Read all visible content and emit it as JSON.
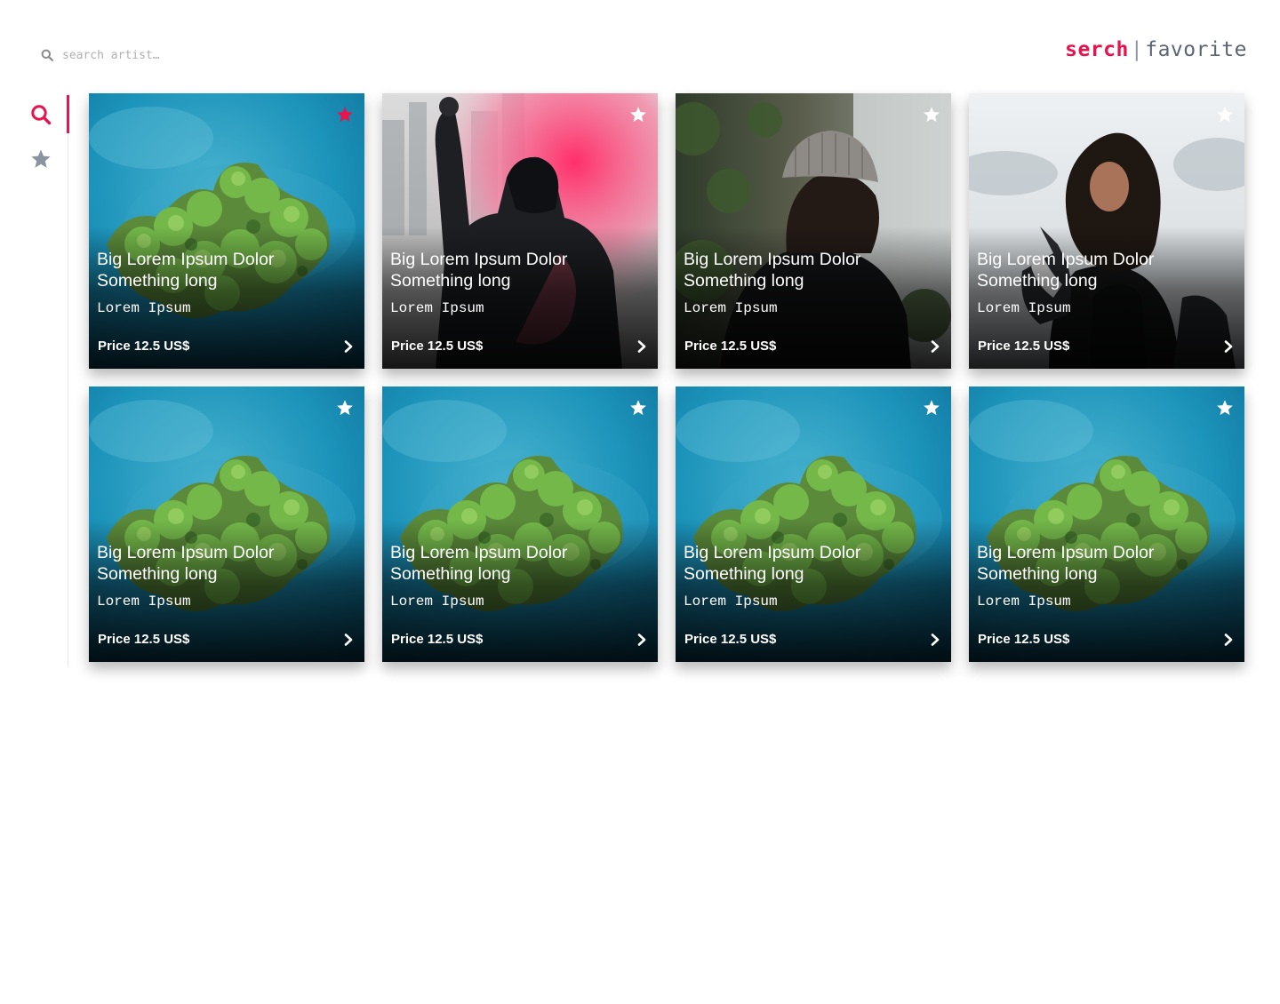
{
  "header": {
    "search_placeholder": "search artist…",
    "logo_brand": "serch",
    "logo_separator": "|",
    "logo_section": "favorite"
  },
  "sidebar": {
    "items": [
      {
        "icon": "search-icon",
        "active": true
      },
      {
        "icon": "star-icon",
        "active": false
      }
    ]
  },
  "colors": {
    "accent": "#e8124d",
    "inactive_icon": "#8a93a0"
  },
  "cards": [
    {
      "title": "Big Lorem Ipsum Dolor Something long",
      "artist": "Lorem Ipsum",
      "price": "Price 12.5 US$",
      "image": "aerial-island",
      "favorited": true
    },
    {
      "title": "Big Lorem Ipsum Dolor Something long",
      "artist": "Lorem Ipsum",
      "price": "Price 12.5 US$",
      "image": "hooded-person-pink-smoke",
      "favorited": false
    },
    {
      "title": "Big Lorem Ipsum Dolor Something long",
      "artist": "Lorem Ipsum",
      "price": "Price 12.5 US$",
      "image": "person-beanie-waterfall",
      "favorited": false
    },
    {
      "title": "Big Lorem Ipsum Dolor Something long",
      "artist": "Lorem Ipsum",
      "price": "Price 12.5 US$",
      "image": "woman-with-husky-snow",
      "favorited": false
    },
    {
      "title": "Big Lorem Ipsum Dolor Something long",
      "artist": "Lorem Ipsum",
      "price": "Price 12.5 US$",
      "image": "aerial-island",
      "favorited": false
    },
    {
      "title": "Big Lorem Ipsum Dolor Something long",
      "artist": "Lorem Ipsum",
      "price": "Price 12.5 US$",
      "image": "aerial-island",
      "favorited": false
    },
    {
      "title": "Big Lorem Ipsum Dolor Something long",
      "artist": "Lorem Ipsum",
      "price": "Price 12.5 US$",
      "image": "aerial-island",
      "favorited": false
    },
    {
      "title": "Big Lorem Ipsum Dolor Something long",
      "artist": "Lorem Ipsum",
      "price": "Price 12.5 US$",
      "image": "aerial-island",
      "favorited": false
    }
  ]
}
